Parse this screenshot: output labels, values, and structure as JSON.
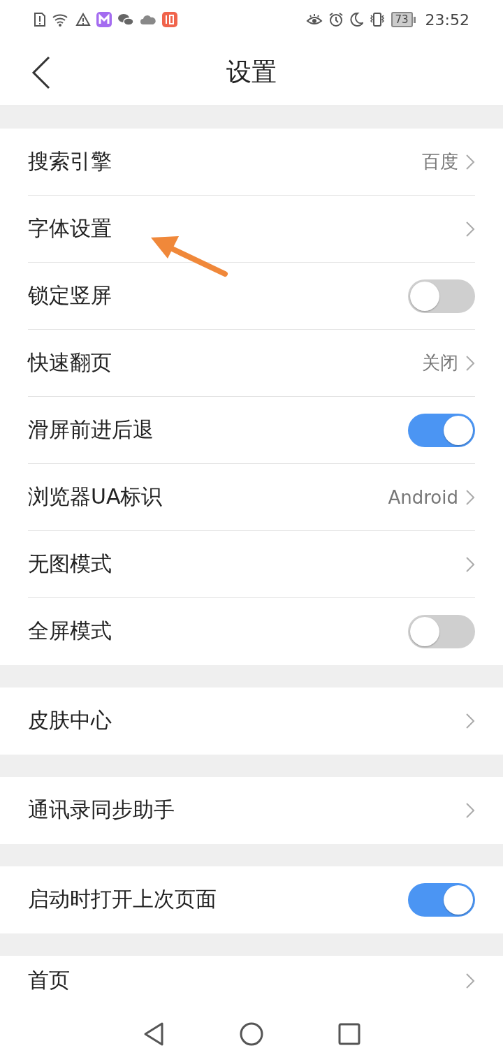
{
  "status_bar": {
    "battery": "73",
    "time": "23:52"
  },
  "header": {
    "title": "设置"
  },
  "groups": [
    [
      {
        "kind": "link",
        "label": "搜索引擎",
        "value": "百度"
      },
      {
        "kind": "link",
        "label": "字体设置"
      },
      {
        "kind": "toggle",
        "label": "锁定竖屏",
        "on": false
      },
      {
        "kind": "link",
        "label": "快速翻页",
        "value": "关闭"
      },
      {
        "kind": "toggle",
        "label": "滑屏前进后退",
        "on": true
      },
      {
        "kind": "link",
        "label": "浏览器UA标识",
        "value": "Android"
      },
      {
        "kind": "link",
        "label": "无图模式"
      },
      {
        "kind": "toggle",
        "label": "全屏模式",
        "on": false
      }
    ],
    [
      {
        "kind": "link",
        "label": "皮肤中心"
      }
    ],
    [
      {
        "kind": "link",
        "label": "通讯录同步助手"
      }
    ],
    [
      {
        "kind": "toggle",
        "label": "启动时打开上次页面",
        "on": true
      }
    ],
    [
      {
        "kind": "link",
        "label": "首页"
      }
    ]
  ]
}
